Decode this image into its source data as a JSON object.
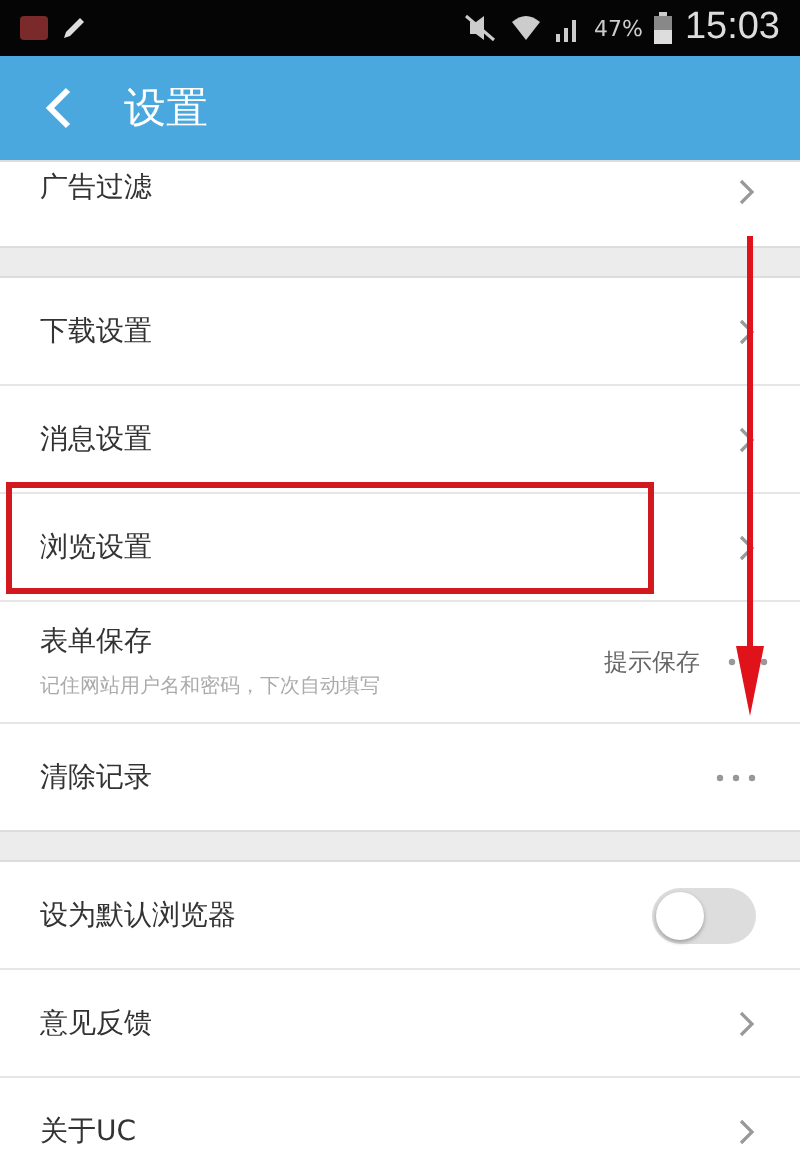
{
  "status_bar": {
    "battery": "47%",
    "time": "15:03"
  },
  "header": {
    "title": "设置"
  },
  "groups": [
    {
      "items": [
        {
          "kind": "chevron",
          "label": "广告过滤"
        }
      ]
    },
    {
      "items": [
        {
          "kind": "chevron",
          "label": "下载设置"
        },
        {
          "kind": "chevron",
          "label": "消息设置"
        },
        {
          "kind": "chevron",
          "label": "浏览设置"
        },
        {
          "kind": "ellipsis",
          "label": "表单保存",
          "subtitle": "记住网站用户名和密码，下次自动填写",
          "value": "提示保存"
        },
        {
          "kind": "ellipsis",
          "label": "清除记录"
        }
      ]
    },
    {
      "items": [
        {
          "kind": "toggle",
          "label": "设为默认浏览器",
          "on": false
        },
        {
          "kind": "chevron",
          "label": "意见反馈"
        },
        {
          "kind": "chevron",
          "label": "关于UC"
        }
      ]
    }
  ]
}
